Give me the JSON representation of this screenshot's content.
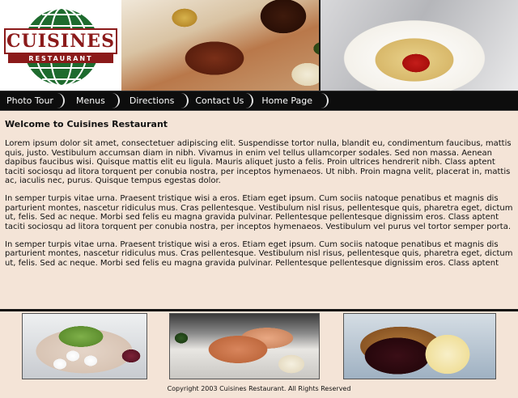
{
  "logo": {
    "brand_name": "CUISINES",
    "brand_sub": "RESTAURANT"
  },
  "nav": {
    "items": [
      {
        "label": "Photo Tour"
      },
      {
        "label": "Menus"
      },
      {
        "label": "Directions"
      },
      {
        "label": "Contact Us"
      },
      {
        "label": "Home Page"
      }
    ]
  },
  "main": {
    "title": "Welcome to Cuisines Restaurant",
    "paragraphs": [
      "Lorem ipsum dolor sit amet, consectetuer adipiscing elit. Suspendisse tortor nulla, blandit eu, condimentum faucibus, mattis quis, justo. Vestibulum accumsan diam in nibh. Vivamus in enim vel tellus ullamcorper sodales. Sed non massa. Aenean dapibus faucibus wisi. Quisque mattis elit eu ligula. Mauris aliquet justo a felis. Proin ultrices hendrerit nibh. Class aptent taciti sociosqu ad litora torquent per conubia nostra, per inceptos hymenaeos. Ut nibh. Proin magna velit, placerat in, mattis ac, iaculis nec, purus. Quisque tempus egestas dolor.",
      "In semper turpis vitae urna. Praesent tristique wisi a eros. Etiam eget ipsum. Cum sociis natoque penatibus et magnis dis parturient montes, nascetur ridiculus mus. Cras pellentesque. Vestibulum nisl risus, pellentesque quis, pharetra eget, dictum ut, felis. Sed ac neque. Morbi sed felis eu magna gravida pulvinar. Pellentesque pellentesque dignissim eros. Class aptent taciti sociosqu ad litora torquent per conubia nostra, per inceptos hymenaeos. Vestibulum vel purus vel tortor semper porta.",
      "In semper turpis vitae urna. Praesent tristique wisi a eros. Etiam eget ipsum. Cum sociis natoque penatibus et magnis dis parturient montes, nascetur ridiculus mus. Cras pellentesque. Vestibulum nisl risus, pellentesque quis, pharetra eget, dictum ut, felis. Sed ac neque. Morbi sed felis eu magna gravida pulvinar. Pellentesque pellentesque dignissim eros. Class aptent"
    ]
  },
  "footer": {
    "copyright": "Copyright 2003 Cuisines Restaurant. All Rights Reserved"
  },
  "colors": {
    "page_background": "#f4e4d7",
    "nav_background": "#0d0d0d",
    "logo_red": "#8b1a1a",
    "logo_green": "#1e6b2e"
  }
}
